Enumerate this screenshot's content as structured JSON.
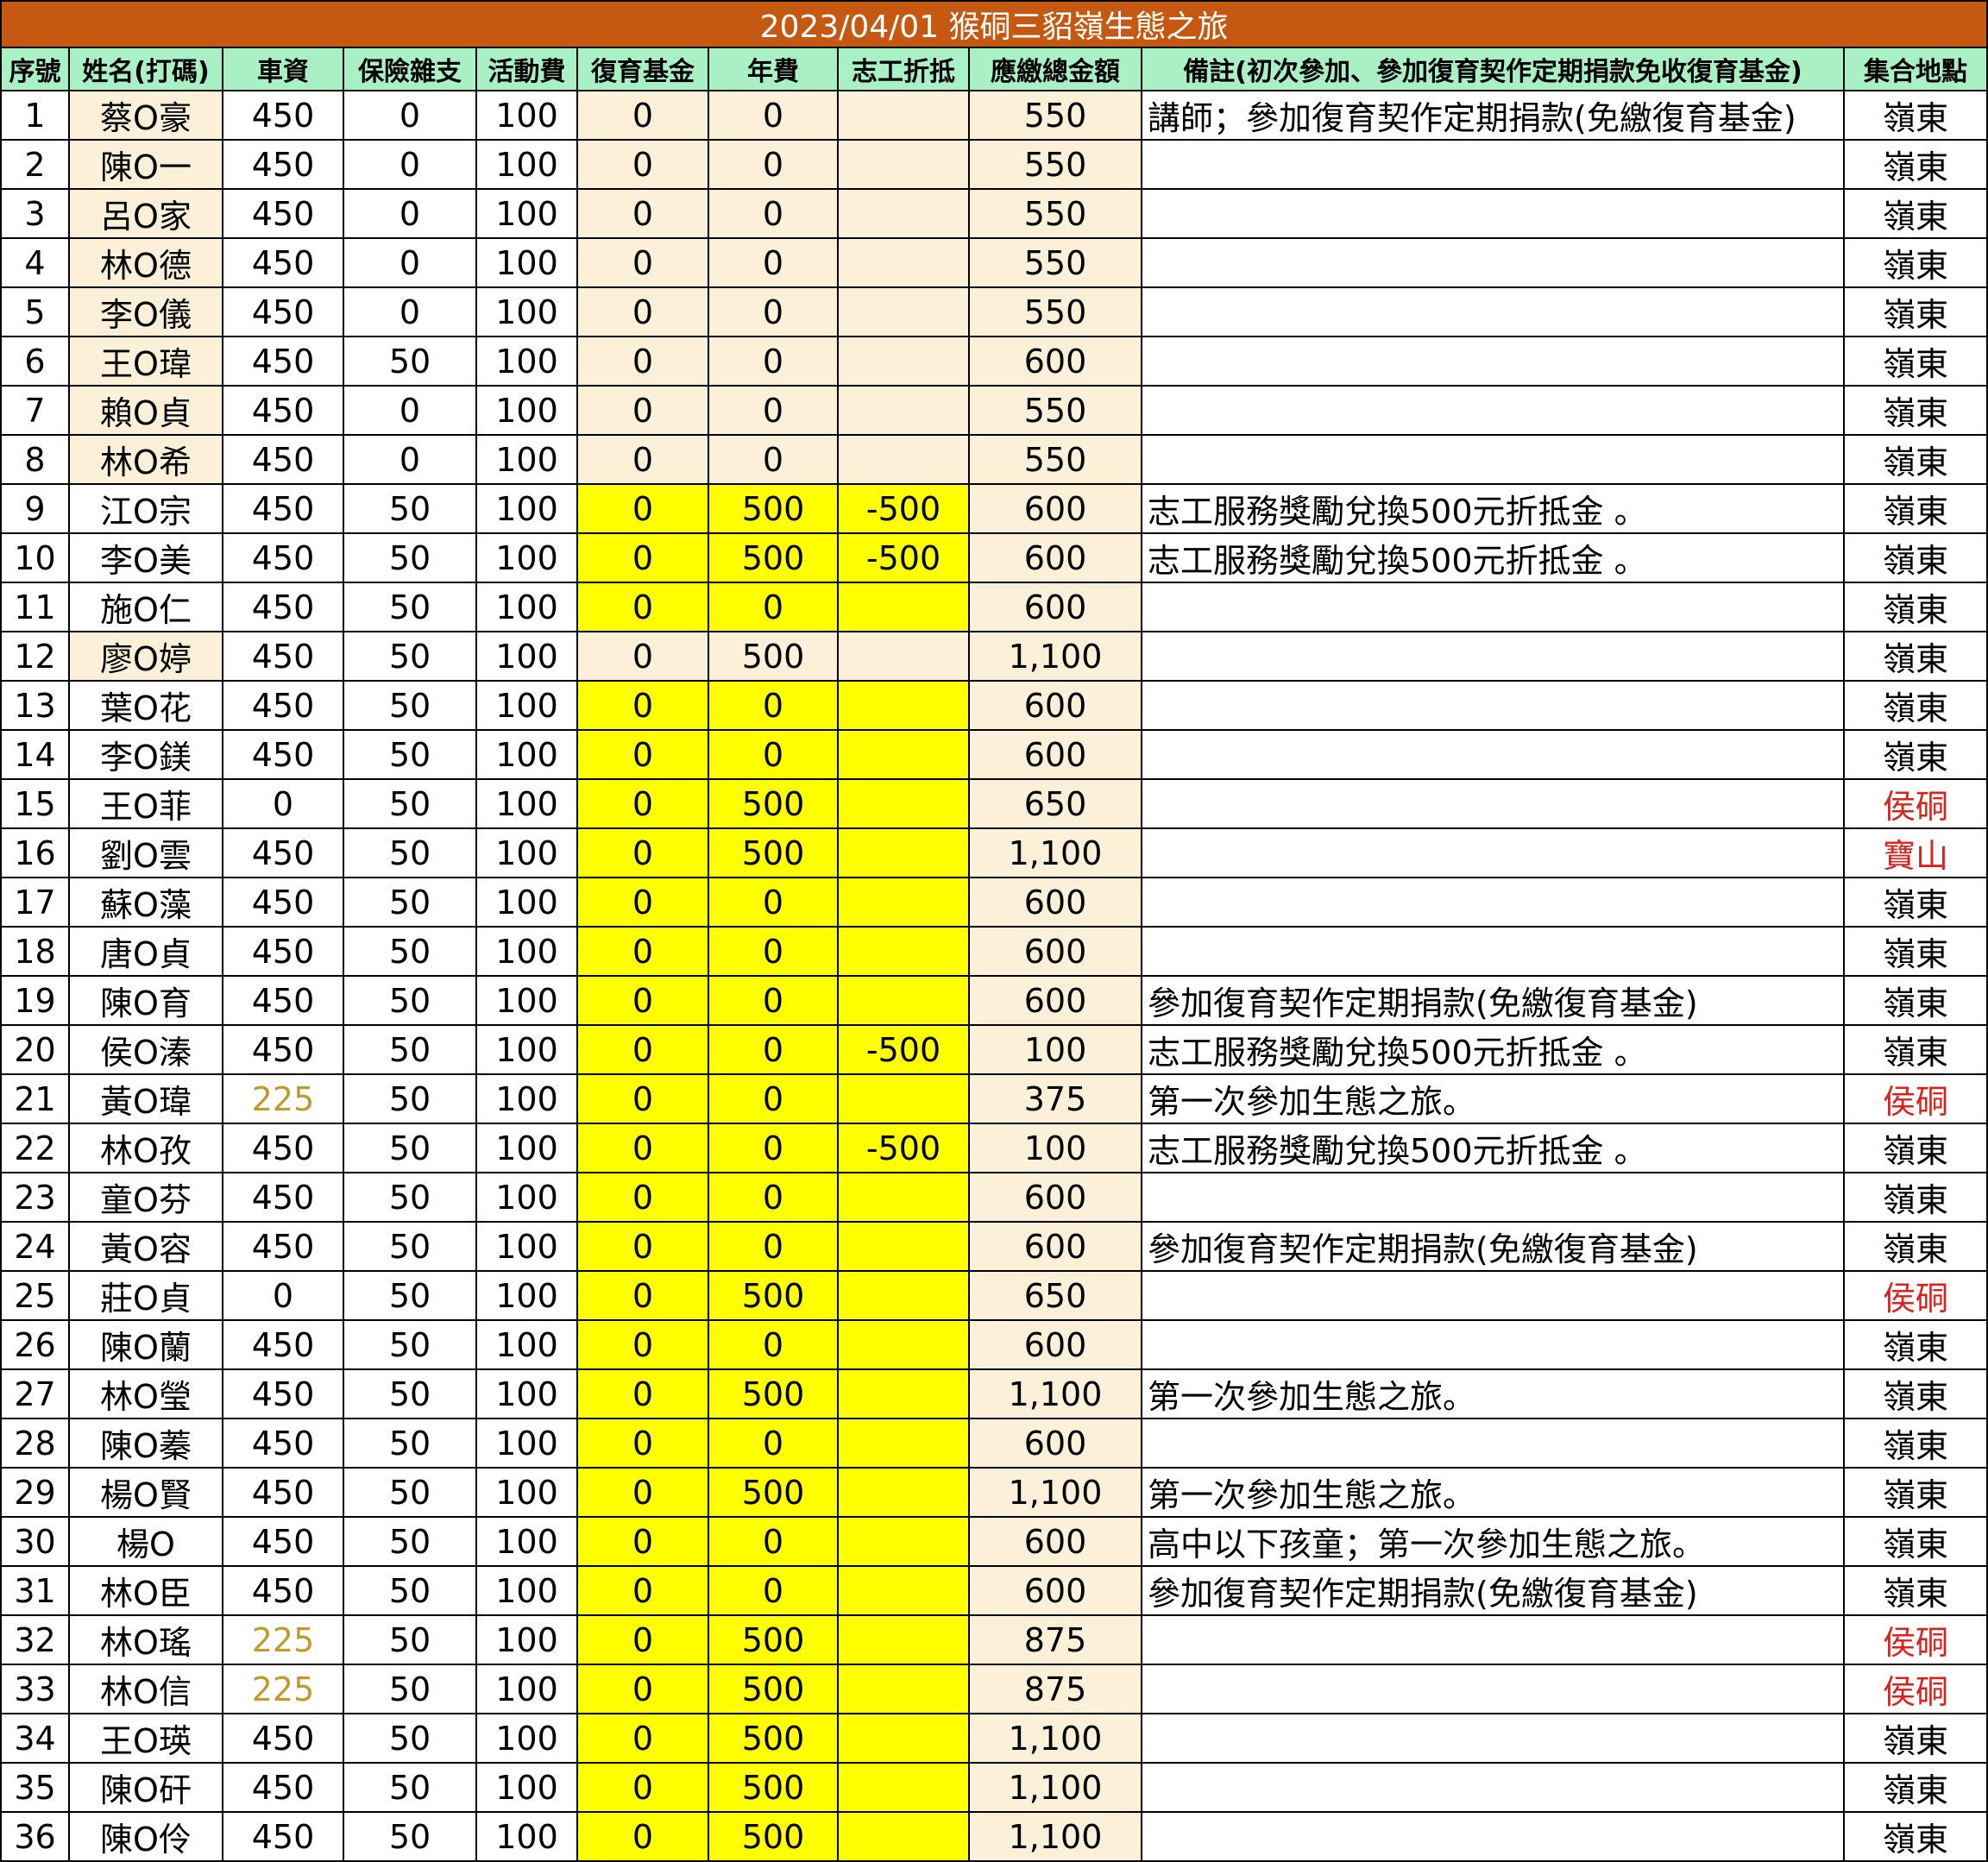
{
  "title": "2023/04/01 猴硐三貂嶺生態之旅",
  "headers": [
    "序號",
    "姓名(打碼)",
    "車資",
    "保險雜支",
    "活動費",
    "復育基金",
    "年費",
    "志工折抵",
    "應繳總金額",
    "備註(初次參加、參加復育契作定期捐款免收復育基金)",
    "集合地點"
  ],
  "rows": [
    {
      "no": "1",
      "name": "蔡O豪",
      "fare": "450",
      "ins": "0",
      "act": "100",
      "fund": "0",
      "annual": "0",
      "vol": "",
      "total": "550",
      "note": "講師；參加復育契作定期捐款(免繳復育基金)",
      "loc": "嶺東",
      "hl": "tan",
      "locred": false,
      "faregold": false
    },
    {
      "no": "2",
      "name": "陳O一",
      "fare": "450",
      "ins": "0",
      "act": "100",
      "fund": "0",
      "annual": "0",
      "vol": "",
      "total": "550",
      "note": "",
      "loc": "嶺東",
      "hl": "tan",
      "locred": false,
      "faregold": false
    },
    {
      "no": "3",
      "name": "呂O家",
      "fare": "450",
      "ins": "0",
      "act": "100",
      "fund": "0",
      "annual": "0",
      "vol": "",
      "total": "550",
      "note": "",
      "loc": "嶺東",
      "hl": "tan",
      "locred": false,
      "faregold": false
    },
    {
      "no": "4",
      "name": "林O德",
      "fare": "450",
      "ins": "0",
      "act": "100",
      "fund": "0",
      "annual": "0",
      "vol": "",
      "total": "550",
      "note": "",
      "loc": "嶺東",
      "hl": "tan",
      "locred": false,
      "faregold": false
    },
    {
      "no": "5",
      "name": "李O儀",
      "fare": "450",
      "ins": "0",
      "act": "100",
      "fund": "0",
      "annual": "0",
      "vol": "",
      "total": "550",
      "note": "",
      "loc": "嶺東",
      "hl": "tan",
      "locred": false,
      "faregold": false
    },
    {
      "no": "6",
      "name": "王O瑋",
      "fare": "450",
      "ins": "50",
      "act": "100",
      "fund": "0",
      "annual": "0",
      "vol": "",
      "total": "600",
      "note": "",
      "loc": "嶺東",
      "hl": "tan",
      "locred": false,
      "faregold": false
    },
    {
      "no": "7",
      "name": "賴O貞",
      "fare": "450",
      "ins": "0",
      "act": "100",
      "fund": "0",
      "annual": "0",
      "vol": "",
      "total": "550",
      "note": "",
      "loc": "嶺東",
      "hl": "tan",
      "locred": false,
      "faregold": false
    },
    {
      "no": "8",
      "name": "林O希",
      "fare": "450",
      "ins": "0",
      "act": "100",
      "fund": "0",
      "annual": "0",
      "vol": "",
      "total": "550",
      "note": "",
      "loc": "嶺東",
      "hl": "tan",
      "locred": false,
      "faregold": false
    },
    {
      "no": "9",
      "name": "江O宗",
      "fare": "450",
      "ins": "50",
      "act": "100",
      "fund": "0",
      "annual": "500",
      "vol": "-500",
      "total": "600",
      "note": "志工服務獎勵兌換500元折抵金 。",
      "loc": "嶺東",
      "hl": "yel",
      "locred": false,
      "faregold": false
    },
    {
      "no": "10",
      "name": "李O美",
      "fare": "450",
      "ins": "50",
      "act": "100",
      "fund": "0",
      "annual": "500",
      "vol": "-500",
      "total": "600",
      "note": "志工服務獎勵兌換500元折抵金 。",
      "loc": "嶺東",
      "hl": "yel",
      "locred": false,
      "faregold": false
    },
    {
      "no": "11",
      "name": "施O仁",
      "fare": "450",
      "ins": "50",
      "act": "100",
      "fund": "0",
      "annual": "0",
      "vol": "",
      "total": "600",
      "note": "",
      "loc": "嶺東",
      "hl": "yel",
      "locred": false,
      "faregold": false
    },
    {
      "no": "12",
      "name": "廖O婷",
      "fare": "450",
      "ins": "50",
      "act": "100",
      "fund": "0",
      "annual": "500",
      "vol": "",
      "total": "1,100",
      "note": "",
      "loc": "嶺東",
      "hl": "tan",
      "locred": false,
      "faregold": false
    },
    {
      "no": "13",
      "name": "葉O花",
      "fare": "450",
      "ins": "50",
      "act": "100",
      "fund": "0",
      "annual": "0",
      "vol": "",
      "total": "600",
      "note": "",
      "loc": "嶺東",
      "hl": "yel",
      "locred": false,
      "faregold": false
    },
    {
      "no": "14",
      "name": "李O鎂",
      "fare": "450",
      "ins": "50",
      "act": "100",
      "fund": "0",
      "annual": "0",
      "vol": "",
      "total": "600",
      "note": "",
      "loc": "嶺東",
      "hl": "yel",
      "locred": false,
      "faregold": false
    },
    {
      "no": "15",
      "name": "王O菲",
      "fare": "0",
      "ins": "50",
      "act": "100",
      "fund": "0",
      "annual": "500",
      "vol": "",
      "total": "650",
      "note": "",
      "loc": "侯硐",
      "hl": "yel",
      "locred": true,
      "faregold": false
    },
    {
      "no": "16",
      "name": "劉O雲",
      "fare": "450",
      "ins": "50",
      "act": "100",
      "fund": "0",
      "annual": "500",
      "vol": "",
      "total": "1,100",
      "note": "",
      "loc": "寶山",
      "hl": "yel",
      "locred": true,
      "faregold": false
    },
    {
      "no": "17",
      "name": "蘇O藻",
      "fare": "450",
      "ins": "50",
      "act": "100",
      "fund": "0",
      "annual": "0",
      "vol": "",
      "total": "600",
      "note": "",
      "loc": "嶺東",
      "hl": "yel",
      "locred": false,
      "faregold": false
    },
    {
      "no": "18",
      "name": "唐O貞",
      "fare": "450",
      "ins": "50",
      "act": "100",
      "fund": "0",
      "annual": "0",
      "vol": "",
      "total": "600",
      "note": "",
      "loc": "嶺東",
      "hl": "yel",
      "locred": false,
      "faregold": false
    },
    {
      "no": "19",
      "name": "陳O育",
      "fare": "450",
      "ins": "50",
      "act": "100",
      "fund": "0",
      "annual": "0",
      "vol": "",
      "total": "600",
      "note": "參加復育契作定期捐款(免繳復育基金)",
      "loc": "嶺東",
      "hl": "yel",
      "locred": false,
      "faregold": false
    },
    {
      "no": "20",
      "name": "侯O溱",
      "fare": "450",
      "ins": "50",
      "act": "100",
      "fund": "0",
      "annual": "0",
      "vol": "-500",
      "total": "100",
      "note": "志工服務獎勵兌換500元折抵金 。",
      "loc": "嶺東",
      "hl": "yel",
      "locred": false,
      "faregold": false
    },
    {
      "no": "21",
      "name": "黃O瑋",
      "fare": "225",
      "ins": "50",
      "act": "100",
      "fund": "0",
      "annual": "0",
      "vol": "",
      "total": "375",
      "note": "第一次參加生態之旅。",
      "loc": "侯硐",
      "hl": "yel",
      "locred": true,
      "faregold": true
    },
    {
      "no": "22",
      "name": "林O孜",
      "fare": "450",
      "ins": "50",
      "act": "100",
      "fund": "0",
      "annual": "0",
      "vol": "-500",
      "total": "100",
      "note": "志工服務獎勵兌換500元折抵金 。",
      "loc": "嶺東",
      "hl": "yel",
      "locred": false,
      "faregold": false
    },
    {
      "no": "23",
      "name": "童O芬",
      "fare": "450",
      "ins": "50",
      "act": "100",
      "fund": "0",
      "annual": "0",
      "vol": "",
      "total": "600",
      "note": "",
      "loc": "嶺東",
      "hl": "yel",
      "locred": false,
      "faregold": false
    },
    {
      "no": "24",
      "name": "黃O容",
      "fare": "450",
      "ins": "50",
      "act": "100",
      "fund": "0",
      "annual": "0",
      "vol": "",
      "total": "600",
      "note": "參加復育契作定期捐款(免繳復育基金)",
      "loc": "嶺東",
      "hl": "yel",
      "locred": false,
      "faregold": false
    },
    {
      "no": "25",
      "name": "莊O貞",
      "fare": "0",
      "ins": "50",
      "act": "100",
      "fund": "0",
      "annual": "500",
      "vol": "",
      "total": "650",
      "note": "",
      "loc": "侯硐",
      "hl": "yel",
      "locred": true,
      "faregold": false
    },
    {
      "no": "26",
      "name": "陳O蘭",
      "fare": "450",
      "ins": "50",
      "act": "100",
      "fund": "0",
      "annual": "0",
      "vol": "",
      "total": "600",
      "note": "",
      "loc": "嶺東",
      "hl": "yel",
      "locred": false,
      "faregold": false
    },
    {
      "no": "27",
      "name": "林O瑩",
      "fare": "450",
      "ins": "50",
      "act": "100",
      "fund": "0",
      "annual": "500",
      "vol": "",
      "total": "1,100",
      "note": "第一次參加生態之旅。",
      "loc": "嶺東",
      "hl": "yel",
      "locred": false,
      "faregold": false
    },
    {
      "no": "28",
      "name": "陳O蓁",
      "fare": "450",
      "ins": "50",
      "act": "100",
      "fund": "0",
      "annual": "0",
      "vol": "",
      "total": "600",
      "note": "",
      "loc": "嶺東",
      "hl": "yel",
      "locred": false,
      "faregold": false
    },
    {
      "no": "29",
      "name": "楊O賢",
      "fare": "450",
      "ins": "50",
      "act": "100",
      "fund": "0",
      "annual": "500",
      "vol": "",
      "total": "1,100",
      "note": "第一次參加生態之旅。",
      "loc": "嶺東",
      "hl": "yel",
      "locred": false,
      "faregold": false
    },
    {
      "no": "30",
      "name": "楊O",
      "fare": "450",
      "ins": "50",
      "act": "100",
      "fund": "0",
      "annual": "0",
      "vol": "",
      "total": "600",
      "note": "高中以下孩童；第一次參加生態之旅。",
      "loc": "嶺東",
      "hl": "yel",
      "locred": false,
      "faregold": false
    },
    {
      "no": "31",
      "name": "林O臣",
      "fare": "450",
      "ins": "50",
      "act": "100",
      "fund": "0",
      "annual": "0",
      "vol": "",
      "total": "600",
      "note": "參加復育契作定期捐款(免繳復育基金)",
      "loc": "嶺東",
      "hl": "yel",
      "locred": false,
      "faregold": false
    },
    {
      "no": "32",
      "name": "林O瑤",
      "fare": "225",
      "ins": "50",
      "act": "100",
      "fund": "0",
      "annual": "500",
      "vol": "",
      "total": "875",
      "note": "",
      "loc": "侯硐",
      "hl": "yel",
      "locred": true,
      "faregold": true
    },
    {
      "no": "33",
      "name": "林O信",
      "fare": "225",
      "ins": "50",
      "act": "100",
      "fund": "0",
      "annual": "500",
      "vol": "",
      "total": "875",
      "note": "",
      "loc": "侯硐",
      "hl": "yel",
      "locred": true,
      "faregold": true
    },
    {
      "no": "34",
      "name": "王O瑛",
      "fare": "450",
      "ins": "50",
      "act": "100",
      "fund": "0",
      "annual": "500",
      "vol": "",
      "total": "1,100",
      "note": "",
      "loc": "嶺東",
      "hl": "yel",
      "locred": false,
      "faregold": false
    },
    {
      "no": "35",
      "name": "陳O矸",
      "fare": "450",
      "ins": "50",
      "act": "100",
      "fund": "0",
      "annual": "500",
      "vol": "",
      "total": "1,100",
      "note": "",
      "loc": "嶺東",
      "hl": "yel",
      "locred": false,
      "faregold": false
    },
    {
      "no": "36",
      "name": "陳O伶",
      "fare": "450",
      "ins": "50",
      "act": "100",
      "fund": "0",
      "annual": "500",
      "vol": "",
      "total": "1,100",
      "note": "",
      "loc": "嶺東",
      "hl": "yel",
      "locred": false,
      "faregold": false
    }
  ],
  "colors": {
    "title_bg": "#c65911",
    "header_bg": "#a9f0c4",
    "tan": "#fdf0d8",
    "yellow": "#ffff00",
    "red_text": "#e0201a",
    "gold_text": "#c09a2a"
  }
}
